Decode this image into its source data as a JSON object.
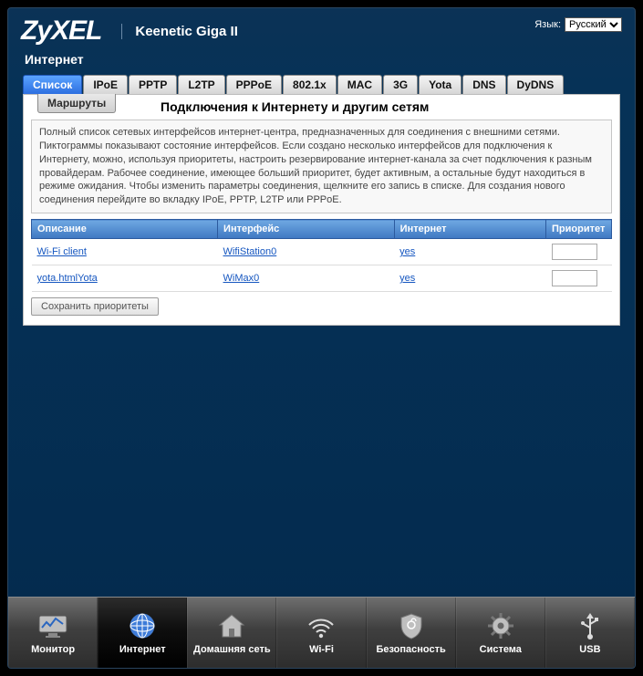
{
  "header": {
    "logo": "ZyXEL",
    "model": "Keenetic Giga II",
    "lang_label": "Язык:",
    "lang_value": "Русский"
  },
  "section": "Интернет",
  "tabs": [
    "Список",
    "IPoE",
    "PPTP",
    "L2TP",
    "PPPoE",
    "802.1x",
    "MAC",
    "3G",
    "Yota",
    "DNS",
    "DyDNS"
  ],
  "active_tab": 0,
  "subtabs": [
    "Маршруты"
  ],
  "panel": {
    "title": "Подключения к Интернету и другим сетям",
    "description": "Полный список сетевых интерфейсов интернет-центра, предназначенных для соединения с внешними сетями. Пиктограммы показывают состояние интерфейсов. Если создано несколько интерфейсов для подключения к Интернету, можно, используя приоритеты, настроить резервирование интернет-канала за счет подключения к разным провайдерам. Рабочее соединение, имеющее больший приоритет, будет активным, а остальные будут находиться в режиме ожидания. Чтобы изменить параметры соединения, щелкните его запись в списке. Для создания нового соединения перейдите во вкладку IPoE, PPTP, L2TP или PPPoE."
  },
  "table": {
    "headers": {
      "desc": "Описание",
      "iface": "Интерфейс",
      "inet": "Интернет",
      "pri": "Приоритет"
    },
    "rows": [
      {
        "desc": "Wi-Fi client",
        "iface": "WifiStation0",
        "inet": "yes",
        "pri": ""
      },
      {
        "desc": "yota.htmlYota",
        "iface": "WiMax0",
        "inet": "yes",
        "pri": ""
      }
    ]
  },
  "buttons": {
    "save": "Сохранить приоритеты"
  },
  "bottomnav": [
    {
      "id": "monitor",
      "label": "Монитор"
    },
    {
      "id": "internet",
      "label": "Интернет"
    },
    {
      "id": "home",
      "label": "Домашняя сеть"
    },
    {
      "id": "wifi",
      "label": "Wi-Fi"
    },
    {
      "id": "security",
      "label": "Безопасность"
    },
    {
      "id": "system",
      "label": "Система"
    },
    {
      "id": "usb",
      "label": "USB"
    }
  ],
  "active_nav": 1
}
